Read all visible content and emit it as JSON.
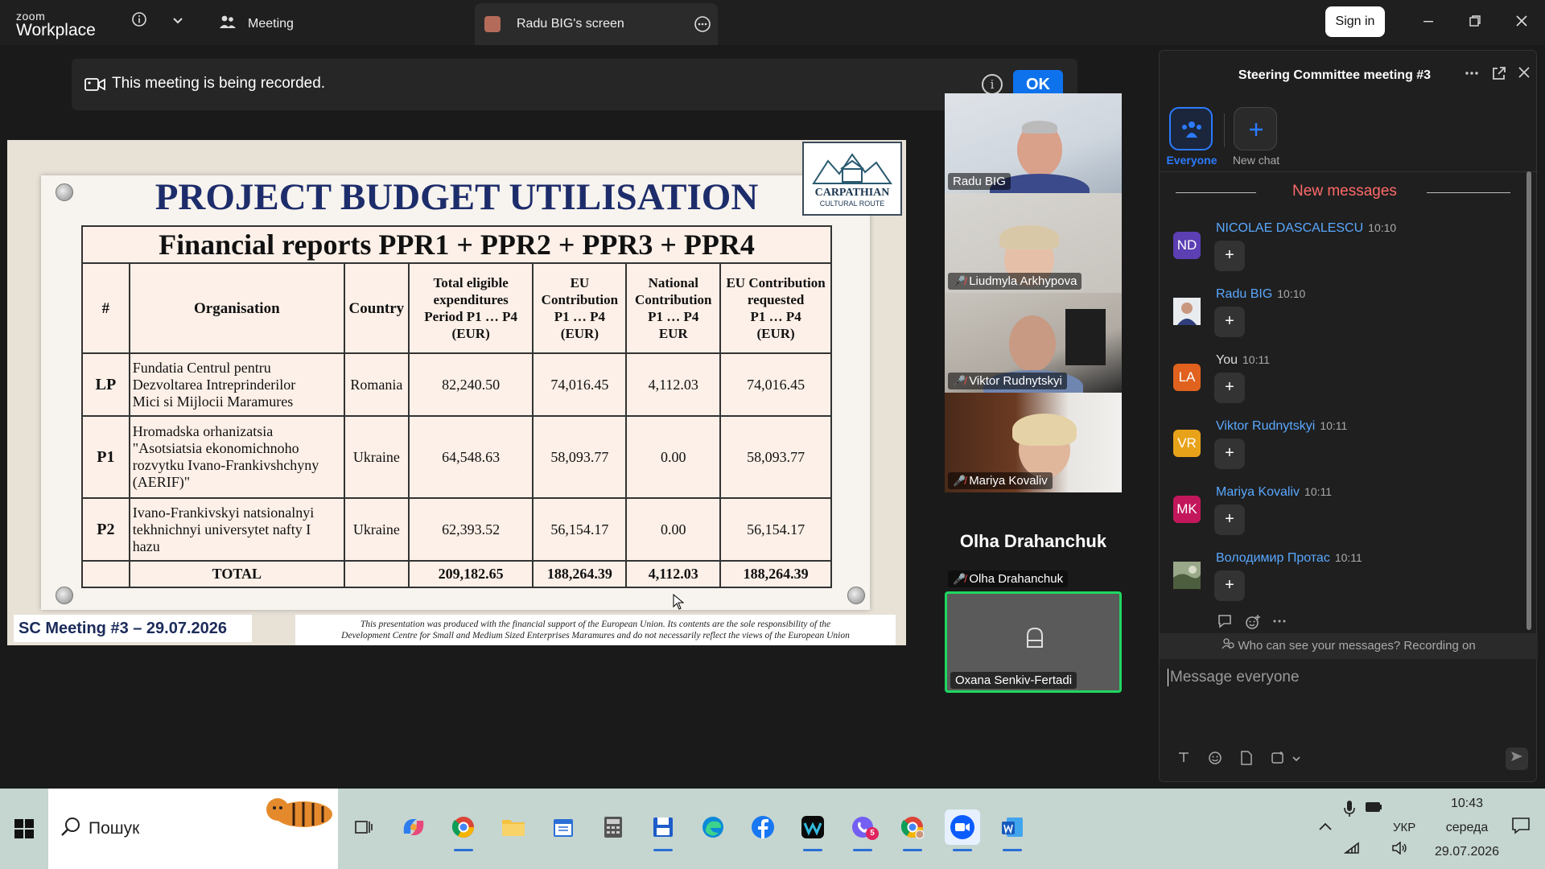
{
  "app": {
    "brand_top": "zoom",
    "brand_bottom": "Workplace",
    "tab_meeting": "Meeting",
    "tab_screen": "Radu BIG's screen",
    "sign_in": "Sign in"
  },
  "banner": {
    "text": "This meeting is being recorded.",
    "ok_label": "OK"
  },
  "slide": {
    "title": "PROJECT BUDGET UTILISATION",
    "logo_line1": "CARPATHIAN",
    "logo_line2": "CULTURAL ROUTE",
    "subtitle": "Financial reports PPR1 + PPR2 + PPR3 + PPR4",
    "headers": {
      "num": "#",
      "org": "Organisation",
      "country": "Country",
      "total_l1": "Total eligible",
      "total_l2": "expenditures",
      "total_l3": "Period P1 … P4",
      "total_l4": "(EUR)",
      "eu_l1": "EU",
      "eu_l2": "Contribution",
      "eu_l3": "P1 … P4",
      "eu_l4": "(EUR)",
      "nat_l1": "National",
      "nat_l2": "Contribution",
      "nat_l3": "P1 … P4",
      "nat_l4": "EUR",
      "req_l1": "EU Contribution",
      "req_l2": "requested",
      "req_l3": "P1 … P4",
      "req_l4": "(EUR)"
    },
    "rows": [
      {
        "code": "LP",
        "org_l1": "Fundatia Centrul pentru",
        "org_l2": "Dezvoltarea Intreprinderilor",
        "org_l3": "Mici si Mijlocii Maramures",
        "org_l4": "",
        "country": "Romania",
        "total": "82,240.50",
        "eu": "74,016.45",
        "national": "4,112.03",
        "requested": "74,016.45"
      },
      {
        "code": "P1",
        "org_l1": "Hromadska orhanizatsia",
        "org_l2": "\"Asotsiatsia ekonomichnoho",
        "org_l3": "rozvytku Ivano-Frankivshchyny",
        "org_l4": "(AERIF)\"",
        "country": "Ukraine",
        "total": "64,548.63",
        "eu": "58,093.77",
        "national": "0.00",
        "requested": "58,093.77"
      },
      {
        "code": "P2",
        "org_l1": "Ivano-Frankivskyi natsionalnyi",
        "org_l2": "tekhnichnyi universytet nafty I",
        "org_l3": "hazu",
        "org_l4": "",
        "country": "Ukraine",
        "total": "62,393.52",
        "eu": "56,154.17",
        "national": "0.00",
        "requested": "56,154.17"
      }
    ],
    "total_row": {
      "label": "TOTAL",
      "total": "209,182.65",
      "eu": "188,264.39",
      "national": "4,112.03",
      "requested": "188,264.39"
    },
    "footer_left": "SC Meeting #3 – 29.07.2026",
    "footer_right_l1": "This presentation was produced with the financial support of the European Union. Its contents are the sole responsibility of the",
    "footer_right_l2": "Development Centre for Small and Medium Sized Enterprises Maramures and do not necessarily reflect the views of the European Union"
  },
  "participants": {
    "radu": "Radu BIG",
    "liudmyla": "Liudmyla Arkhypova",
    "viktor": "Viktor Rudnytskyi",
    "mariya": "Mariya Kovaliv",
    "olha_big": "Olha Drahanchuk",
    "olha_label": "Olha Drahanchuk",
    "oxana": "Oxana Senkiv-Fertadi"
  },
  "chat": {
    "title": "Steering Committee meeting #3",
    "tab_everyone": "Everyone",
    "tab_new_chat": "New chat",
    "new_messages": "New messages",
    "messages": [
      {
        "initials": "ND",
        "name": "NICOLAE DASCALESCU",
        "time": "10:10",
        "color": "#5b3fb3"
      },
      {
        "initials": "",
        "name": "Radu BIG",
        "time": "10:10",
        "color": "#8aa0b8"
      },
      {
        "initials": "LA",
        "name": "You",
        "time": "10:11",
        "color": "#e0621e"
      },
      {
        "initials": "VR",
        "name": "Viktor Rudnytskyi",
        "time": "10:11",
        "color": "#e8a21a"
      },
      {
        "initials": "MK",
        "name": "Mariya Kovaliv",
        "time": "10:11",
        "color": "#c2185b"
      },
      {
        "initials": "",
        "name": "Володимир Протас",
        "time": "10:11",
        "color": "#6a7f5a"
      }
    ],
    "plus": "+",
    "who_can_see": "Who can see your messages? Recording on",
    "input_placeholder": "Message everyone"
  },
  "taskbar": {
    "search_text": "Пошук",
    "time": "10:43",
    "day": "середа",
    "date": "29.07.2026",
    "lang": "УКР",
    "notif_count": "5"
  }
}
